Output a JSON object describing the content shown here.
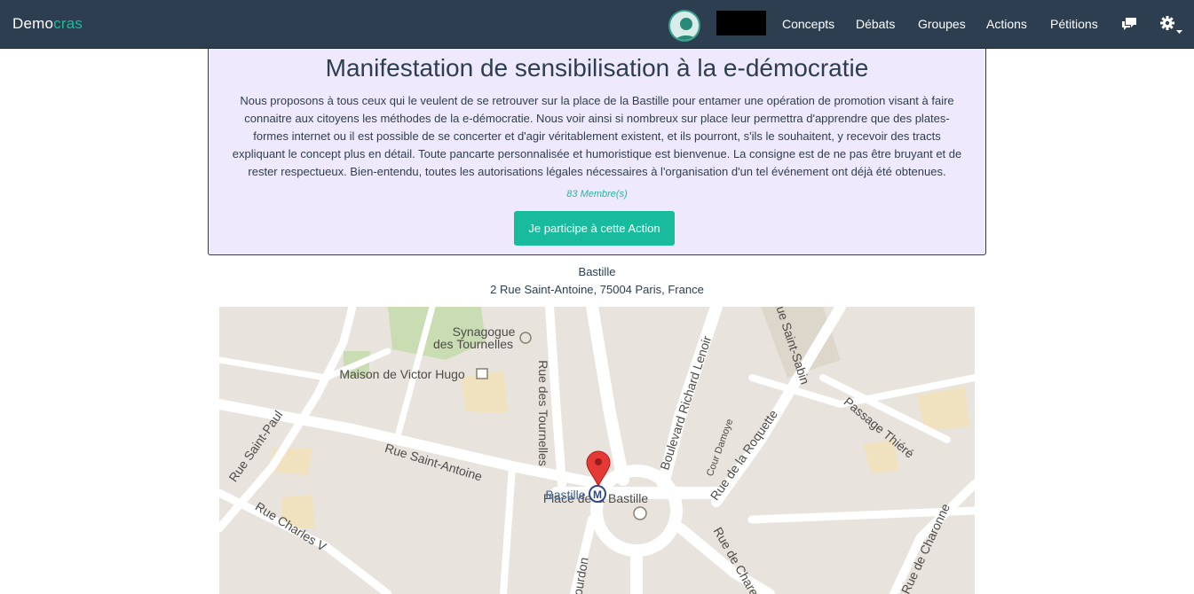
{
  "navbar": {
    "brand_part1": "Demo",
    "brand_part2": "cras",
    "links": [
      "Concepts",
      "Débats",
      "Groupes",
      "Actions",
      "Pétitions"
    ],
    "icons": [
      "chat-icon",
      "gear-icon",
      "caret-down-icon"
    ]
  },
  "action": {
    "title": "Manifestation de sensibilisation à la e-démocratie",
    "description": "Nous proposons à tous ceux qui le veulent de se retrouver sur la place de la Bastille pour entamer une opération de promotion visant à faire connaitre aux citoyens les méthodes de la e-démocratie. Nous voir ainsi si nombreux sur place leur permettra d'apprendre que des plates-formes internet ou il est possible de se concerter et d'agir véritablement existent, et ils pourront, s'ils le souhaitent, y recevoir des tracts expliquant le concept plus en détail. Toute pancarte personnalisée et humoristique est bienvenue. La consigne est de ne pas être bruyant et de rester respectueux. Bien-entendu, toutes les autorisations légales nécessaires à l'organisation d'un tel événement ont déjà été obtenues.",
    "members_count": "83",
    "members_label": "Membre(s)",
    "join_button": "Je participe à cette Action"
  },
  "location": {
    "name": "Bastille",
    "address": "2 Rue Saint-Antoine, 75004 Paris, France"
  },
  "map": {
    "labels": {
      "synagogue_1": "Synagogue",
      "synagogue_2": "des Tournelles",
      "victor_hugo": "Maison de Victor Hugo",
      "rue_tournelles": "Rue des Tournelles",
      "bd_richard_lenoir": "Boulevard Richard Lenoir",
      "rue_st_sabin": "Rue Saint-Sabin",
      "passage_thiere": "Passage Thiéré",
      "rue_st_paul": "Rue Saint-Paul",
      "rue_st_antoine": "Rue Saint-Antoine",
      "cour_damoye": "Cour Damoye",
      "rue_roquette": "Rue de la Roquette",
      "rue_charles_v": "Rue Charles V",
      "bastille_station": "Bastille",
      "place_bastille": "Place de la Bastille",
      "rue_charenton": "Rue de Chare",
      "rue_charonne": "Rue de Charonne",
      "bourdon": "ourdon"
    },
    "metro_symbol": "M"
  },
  "colors": {
    "navbar_bg": "#2c3e50",
    "accent": "#18bc9c",
    "panel_bg": "#efe9fd",
    "marker": "#e53935"
  }
}
